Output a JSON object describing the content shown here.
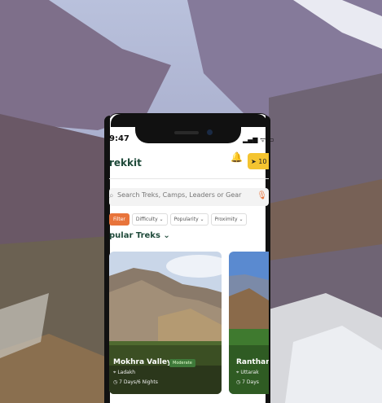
{
  "status_bar": {
    "time": "9:47",
    "icons": "▂▄▆ ᯤ ▭"
  },
  "header": {
    "title": "rekkit",
    "bell_icon": "bell-icon",
    "send_button_label": "10"
  },
  "search": {
    "placeholder": "Search Treks, Camps, Leaders or Gear",
    "icon": "search-icon",
    "mic_icon": "mic-icon"
  },
  "filters": [
    {
      "label": "Filter"
    },
    {
      "label": "Difficulty ⌄"
    },
    {
      "label": "Popularity ⌄"
    },
    {
      "label": "Proximity ⌄"
    }
  ],
  "section": {
    "title": "pular Treks",
    "chevron": "⌄"
  },
  "cards": [
    {
      "name": "Mokhra Valley",
      "badge": "Moderate",
      "location": "Ladakh",
      "duration": "7 Days/6 Nights"
    },
    {
      "name": "Ranthan",
      "location": "Uttarak",
      "duration": "7 Days"
    }
  ],
  "colors": {
    "accent": "#e8743b",
    "brand": "#1f4a3a",
    "highlight": "#f4c430"
  }
}
